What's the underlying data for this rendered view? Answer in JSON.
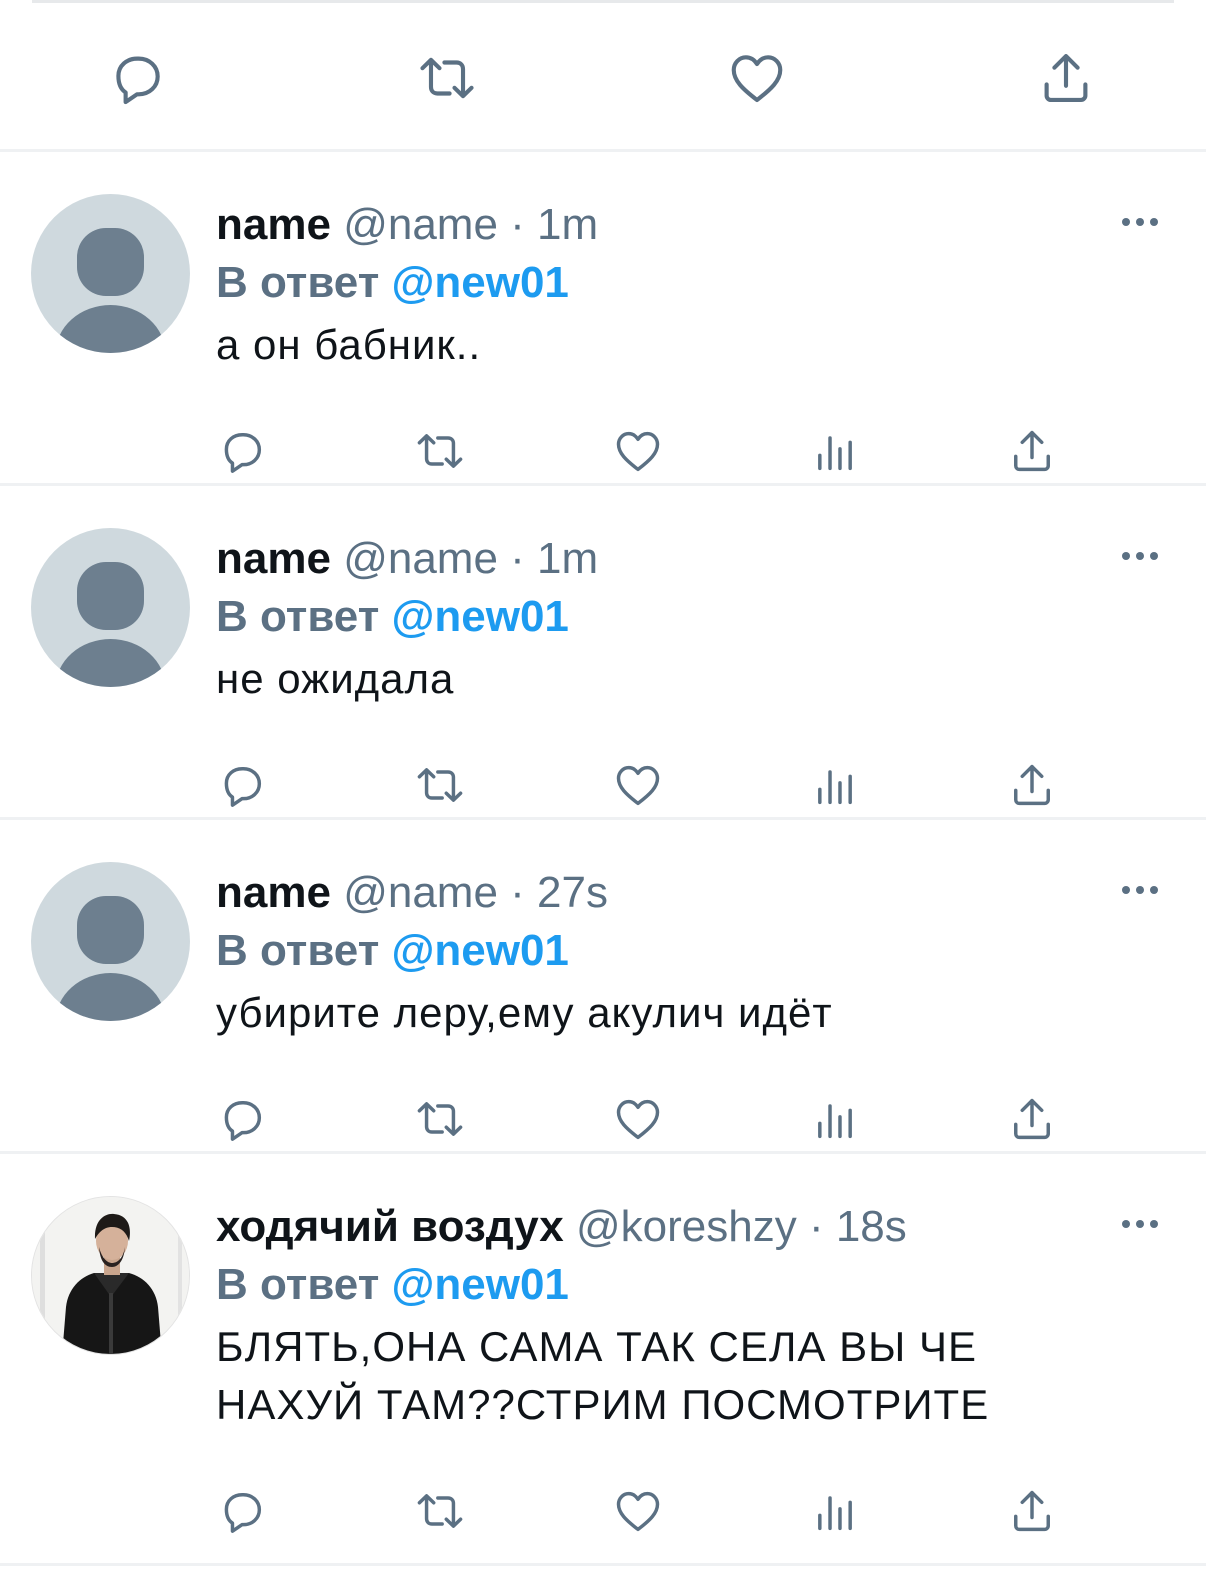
{
  "top_actions": {
    "icons": [
      "reply-icon",
      "retweet-icon",
      "like-icon",
      "share-icon"
    ]
  },
  "tweets": [
    {
      "display_name": "name",
      "handle": "@name",
      "separator": "·",
      "time": "1m",
      "reply_prefix": "В ответ",
      "reply_target": "@new01",
      "text": "а он бабник..",
      "avatar": "default-avatar"
    },
    {
      "display_name": "name",
      "handle": "@name",
      "separator": "·",
      "time": "1m",
      "reply_prefix": "В ответ",
      "reply_target": "@new01",
      "text": "не ожидала",
      "avatar": "default-avatar"
    },
    {
      "display_name": "name",
      "handle": "@name",
      "separator": "·",
      "time": "27s",
      "reply_prefix": "В ответ",
      "reply_target": "@new01",
      "text": "убирите леру,ему акулич идёт",
      "avatar": "default-avatar"
    },
    {
      "display_name": "ходячий воздух",
      "handle": "@koreshzy",
      "separator": "·",
      "time": "18s",
      "reply_prefix": "В ответ",
      "reply_target": "@new01",
      "text": "БЛЯТЬ,ОНА САМА ТАК СЕЛА ВЫ ЧЕ НАХУЙ ТАМ??СТРИМ ПОСМОТРИТЕ",
      "avatar": "photo-avatar"
    }
  ],
  "colors": {
    "text_primary": "#0f1419",
    "text_secondary": "#5b7083",
    "accent": "#1d9bf0",
    "divider": "#eff1f3",
    "avatar_bg": "#cfd9de",
    "avatar_fg": "#6d7f8f"
  }
}
